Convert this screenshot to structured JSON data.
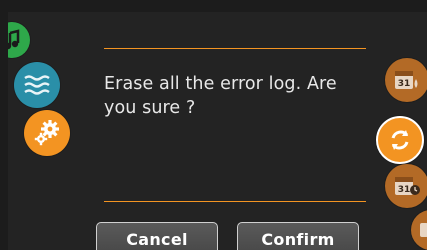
{
  "dialog": {
    "message": "Erase all the error log. Are you sure ?",
    "cancel_label": "Cancel",
    "confirm_label": "Confirm"
  },
  "side_icons": {
    "left": [
      "music-icon",
      "water-level-icon",
      "settings-gears-icon"
    ],
    "right": [
      "calendar-drop-icon",
      "refresh-cycle-icon",
      "calendar-clock-icon",
      "partial-icon"
    ],
    "calendar_day": "31"
  },
  "colors": {
    "background": "#232323",
    "accent_orange": "#f39422",
    "muted_orange": "#c67a2e",
    "teal": "#2a8fa8",
    "green": "#2ea84a",
    "text": "#e8e8e8"
  }
}
